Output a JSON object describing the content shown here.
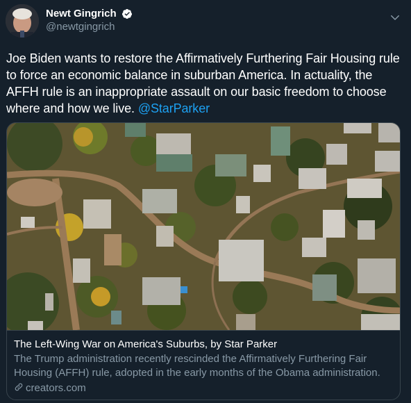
{
  "tweet": {
    "author": {
      "display_name": "Newt Gingrich",
      "handle": "@newtgingrich",
      "verified": true
    },
    "text_before_mention": "Joe Biden wants to restore the Affirmatively Furthering Fair Housing rule to force an economic balance in suburban America. In actuality, the AFFH rule is an inappropriate assault on our basic freedom to choose where and how we live. ",
    "mention": "@StarParker",
    "card": {
      "title": "The Left-Wing War on America's Suburbs, by Star Parker",
      "description": "The Trump administration recently rescinded the Affirmatively Furthering Fair Housing (AFFH) rule, adopted in the early months of the Obama administration. …",
      "domain": "creators.com"
    }
  },
  "colors": {
    "background": "#15202b",
    "text_primary": "#ffffff",
    "text_secondary": "#8899a6",
    "link_blue": "#1da1f2",
    "border": "#38444d"
  },
  "icons": {
    "verified": "verified-badge-icon",
    "menu": "chevron-down-icon",
    "link": "link-icon"
  }
}
